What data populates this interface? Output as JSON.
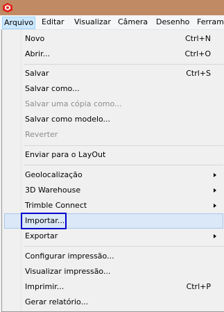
{
  "app": {
    "icon": "sketchup-icon"
  },
  "menubar": {
    "items": [
      {
        "label": "Arquivo"
      },
      {
        "label": "Editar"
      },
      {
        "label": "Visualizar"
      },
      {
        "label": "Câmera"
      },
      {
        "label": "Desenho"
      },
      {
        "label": "Ferram"
      }
    ]
  },
  "menu": {
    "items": [
      {
        "label": "Novo",
        "shortcut": "Ctrl+N"
      },
      {
        "label": "Abrir...",
        "shortcut": "Ctrl+O"
      },
      {
        "label": "Salvar",
        "shortcut": "Ctrl+S"
      },
      {
        "label": "Salvar como..."
      },
      {
        "label": "Salvar uma cópia como..."
      },
      {
        "label": "Salvar como modelo..."
      },
      {
        "label": "Reverter"
      },
      {
        "label": "Enviar para o LayOut"
      },
      {
        "label": "Geolocalização"
      },
      {
        "label": "3D Warehouse"
      },
      {
        "label": "Trimble Connect"
      },
      {
        "label": "Importar..."
      },
      {
        "label": "Exportar"
      },
      {
        "label": "Configurar impressão..."
      },
      {
        "label": "Visualizar impressão..."
      },
      {
        "label": "Imprimir...",
        "shortcut": "Ctrl+P"
      },
      {
        "label": "Gerar relatório..."
      }
    ]
  },
  "colors": {
    "titlebar": "#c08b64",
    "highlight": "#0000cc",
    "disabled_text": "#8d8d8d"
  }
}
